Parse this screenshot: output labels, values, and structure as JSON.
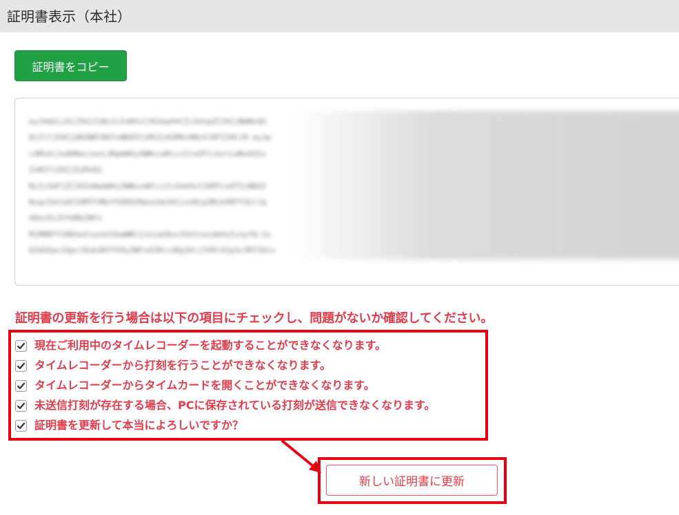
{
  "header": {
    "title": "証明書表示（本社）"
  },
  "toolbar": {
    "copy_label": "証明書をコピー"
  },
  "certificate": {
    "text": "eyJhbGciOiJSUzI1NiIsInR5cCI6IkpXVCIsImtpZCI6IjNmNzQ5\nNjZlYjE0ZjQ0ZWRlNGYxNDQ5YjM2ZjA2MDc0NzVlNTI2OCJ9.eyJp\nc3MiOiJodHRwczovL3RpbWVyZWNvcmRlci5leGFtcGxlLmNvbSIs\nInN1YiI6IjEyMzQ1\nNiIsImF1ZCI6InRpbWVyZWNvcmRlciIsImV4cCI6MTcxOTIzNDU2\nNzgsImlhdCI6MTY4NzY5ODU2NywibmJmIjoxNjg3Njk4NTY3LCJq\ndGkiOiJhYmNkZWYx\nMjM0NTY3ODkwIiwib2ZmaWNlIjoiaG9uc2hhIiwidmVyIjoyfQ.Sx\nQ3dGhpc19pc19ub3RfYV9yZWFsX2NlcnRpZmljYXRlX2p1c3RfZmls"
  },
  "warning": {
    "text": "証明書の更新を行う場合は以下の項目にチェックし、問題がないか確認してください。"
  },
  "checklist": {
    "items": [
      {
        "label": "現在ご利用中のタイムレコーダーを起動することができなくなります。",
        "checked": true
      },
      {
        "label": "タイムレコーダーから打刻を行うことができなくなります。",
        "checked": true
      },
      {
        "label": "タイムレコーダーからタイムカードを開くことができなくなります。",
        "checked": true
      },
      {
        "label": "未送信打刻が存在する場合、PCに保存されている打刻が送信できなくなります。",
        "checked": true
      },
      {
        "label": "証明書を更新して本当によろしいですか？",
        "checked": true
      }
    ]
  },
  "actions": {
    "update_label": "新しい証明書に更新"
  },
  "colors": {
    "primary_green": "#22a045",
    "warning_red": "#e03c4b",
    "annotation_red": "#e60012",
    "titlebar_gray": "#e6e6e6"
  }
}
